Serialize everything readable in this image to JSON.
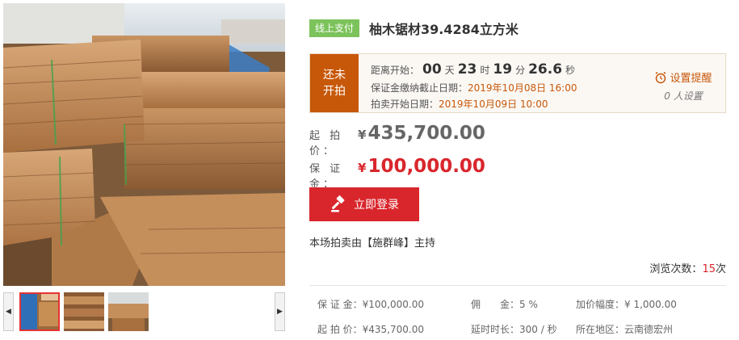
{
  "gallery": {
    "prev_arrow": "◀",
    "next_arrow": "▶"
  },
  "title": {
    "badge": "线上支付",
    "text": "柚木锯材39.4284立方米"
  },
  "countdown": {
    "status_line1": "还未",
    "status_line2": "开拍",
    "label": "距离开始：",
    "days": "00",
    "days_unit": "天",
    "hours": "23",
    "hours_unit": "时",
    "minutes": "19",
    "minutes_unit": "分",
    "seconds": "26.6",
    "seconds_unit": "秒",
    "deposit_deadline_label": "保证金缴纳截止日期：",
    "deposit_deadline_value": "2019年10月08日 16:00",
    "auction_start_label": "拍卖开始日期：",
    "auction_start_value": "2019年10月09日 10:00",
    "reminder_label": "设置提醒",
    "reminder_count": "0 人设置"
  },
  "prices": {
    "start_label": "起 拍 价：",
    "currency": "¥",
    "start_value": "435,700.00",
    "deposit_label": "保 证 金：",
    "deposit_value": "100,000.00"
  },
  "login_button": "立即登录",
  "host_line": "本场拍卖由【施群峰】主持",
  "views": {
    "label": "浏览次数：",
    "count": "15",
    "unit": "次"
  },
  "meta": {
    "deposit": "保 证 金：¥100,000.00",
    "commission": "佣　　金：5 %",
    "increment": "加价幅度：¥ 1,000.00",
    "start_price": "起 拍 价：¥435,700.00",
    "extension": "延时时长：300 / 秒",
    "location": "所在地区：云南德宏州"
  },
  "colors": {
    "accent_orange": "#c7580a",
    "accent_red": "#d9262c",
    "badge_green": "#7cc35b"
  }
}
